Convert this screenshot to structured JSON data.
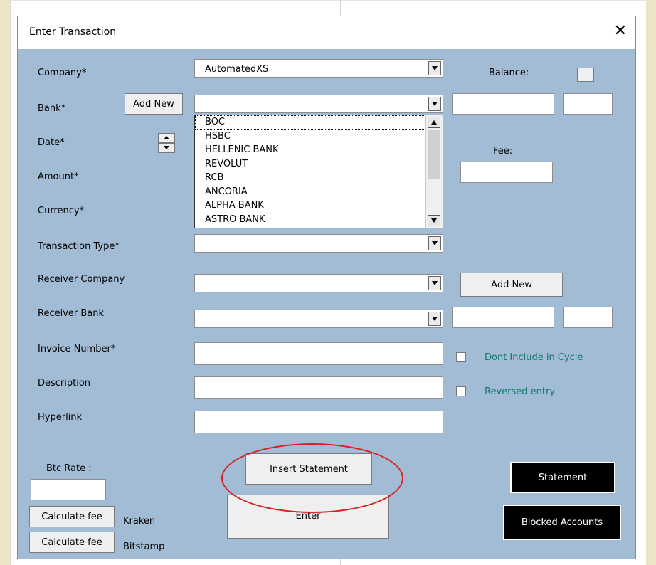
{
  "dialog": {
    "title": "Enter Transaction",
    "close_glyph": "✕"
  },
  "labels": {
    "company": "Company*",
    "bank": "Bank*",
    "date": "Date*",
    "amount": "Amount*",
    "currency": "Currency*",
    "transaction_type": "Transaction Type*",
    "receiver_company": "Receiver Company",
    "receiver_bank": "Receiver Bank",
    "invoice_number": "Invoice Number*",
    "description": "Description",
    "hyperlink": "Hyperlink",
    "balance": "Balance:",
    "fee": "Fee:",
    "btc_rate": "Btc Rate :",
    "kraken": "Kraken",
    "bitstamp": "Bitstamp",
    "dont_include": "Dont Include in Cycle",
    "reversed_entry": "Reversed entry"
  },
  "fields": {
    "company_value": "AutomatedXS",
    "bank_value": "",
    "transaction_type_value": "",
    "receiver_company_value": "",
    "receiver_bank_value": "",
    "invoice_number_value": "",
    "description_value": "",
    "hyperlink_value": "",
    "btc_rate_value": ""
  },
  "buttons": {
    "add_new_bank": "Add New",
    "add_new_receiver": "Add New",
    "balance_toggle": "-",
    "insert_statement": "Insert Statement",
    "enter": "Enter",
    "statement": "Statement",
    "blocked_accounts": "Blocked Accounts",
    "calculate_fee_kraken": "Calculate fee",
    "calculate_fee_bitstamp": "Calculate fee"
  },
  "bank_dropdown": {
    "items": [
      "BOC",
      "HSBC",
      "HELLENIC BANK",
      "REVOLUT",
      "RCB",
      "ANCORIA",
      "ALPHA BANK",
      "ASTRO BANK"
    ],
    "selected_index": 0
  },
  "colors": {
    "dialog_bg": "#a3bcd6",
    "highlight_ring": "#d91f1f",
    "checkbox_label": "#10786a"
  }
}
